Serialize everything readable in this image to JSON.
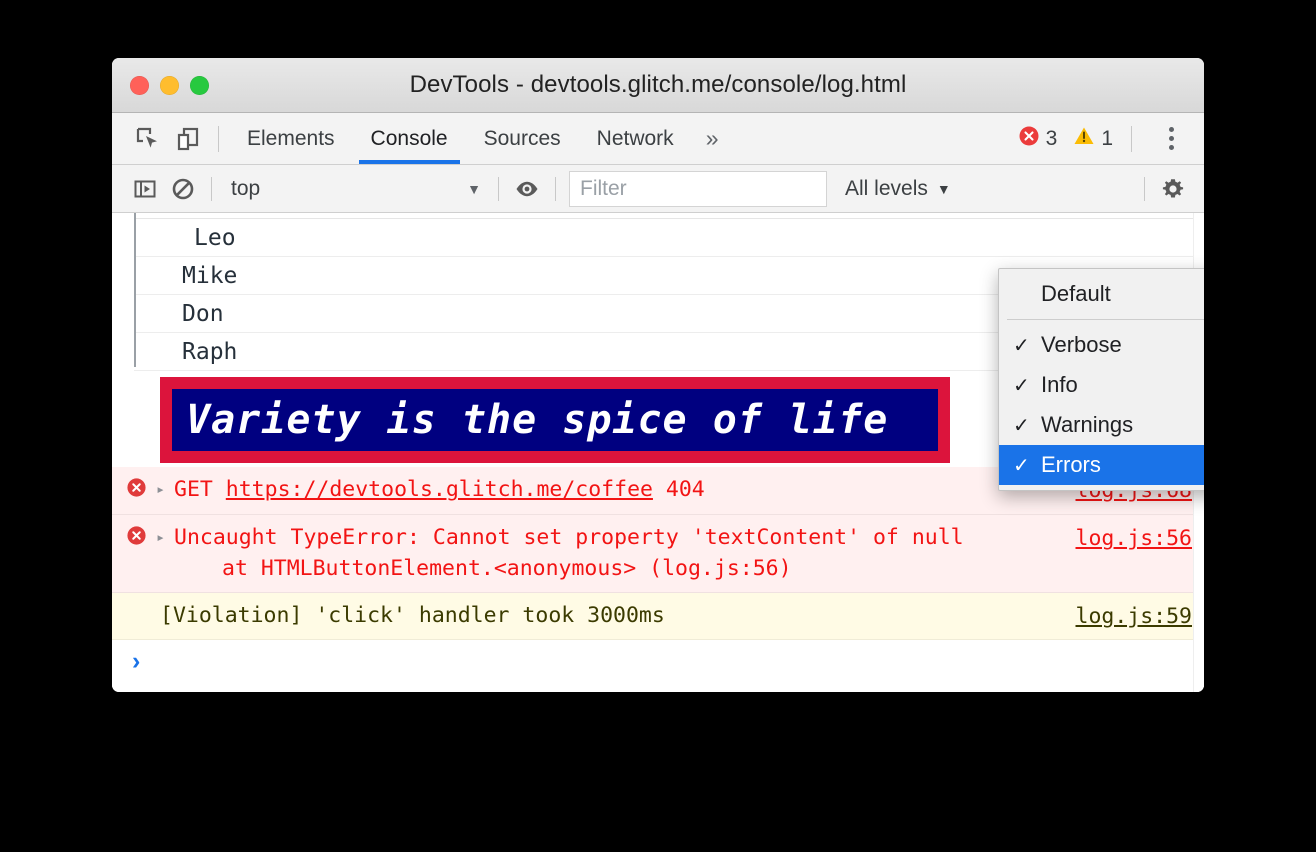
{
  "window": {
    "title": "DevTools - devtools.glitch.me/console/log.html",
    "traffic_lights": [
      "close-button",
      "minimize-button",
      "maximize-button"
    ]
  },
  "tabbar": {
    "inspect_icon": "inspect-element-icon",
    "device_icon": "device-toolbar-icon",
    "tabs": [
      {
        "label": "Elements",
        "active": false
      },
      {
        "label": "Console",
        "active": true
      },
      {
        "label": "Sources",
        "active": false
      },
      {
        "label": "Network",
        "active": false
      }
    ],
    "more_label": "»",
    "error_count": "3",
    "warning_count": "1",
    "error_icon": "error-circle-icon",
    "warning_icon": "warning-triangle-icon",
    "menu_icon": "more-vertical-icon",
    "active_underline_color": "#1a73e8"
  },
  "filterbar": {
    "sidebar_icon": "show-console-sidebar-icon",
    "clear_icon": "clear-console-icon",
    "context": "top",
    "context_caret": "▼",
    "eye_icon": "live-expression-eye-icon",
    "filter_placeholder": "Filter",
    "filter_value": "",
    "levels_label": "All levels",
    "levels_caret": "▼",
    "settings_icon": "settings-gear-icon"
  },
  "levels_menu": {
    "items": [
      {
        "label": "Default",
        "checked": false,
        "selected": false
      },
      {
        "label": "Verbose",
        "checked": true,
        "selected": false
      },
      {
        "label": "Info",
        "checked": true,
        "selected": false
      },
      {
        "label": "Warnings",
        "checked": true,
        "selected": false
      },
      {
        "label": "Errors",
        "checked": true,
        "selected": true
      }
    ],
    "check_glyph": "✓",
    "highlight_color": "#1a73e8"
  },
  "console": {
    "group_names": [
      "Leo",
      "Mike",
      "Don",
      "Raph"
    ],
    "banner": {
      "text": "Variety is the spice of life",
      "background_color": "#000080",
      "border_color": "#dc143c",
      "text_color": "#ffffff"
    },
    "messages": [
      {
        "kind": "error",
        "expand_arrow": "▸",
        "icon": "error-circle-icon",
        "method": "GET",
        "url": "https://devtools.glitch.me/coffee",
        "status": "404",
        "source": "log.js:68"
      },
      {
        "kind": "error",
        "expand_arrow": "▸",
        "icon": "error-circle-icon",
        "text": "Uncaught TypeError: Cannot set property 'textContent' of null",
        "stack": "at HTMLButtonElement.<anonymous> (log.js:56)",
        "source": "log.js:56"
      },
      {
        "kind": "warning",
        "text": "[Violation] 'click' handler took 3000ms",
        "source": "log.js:59"
      }
    ],
    "prompt_glyph": "›"
  }
}
